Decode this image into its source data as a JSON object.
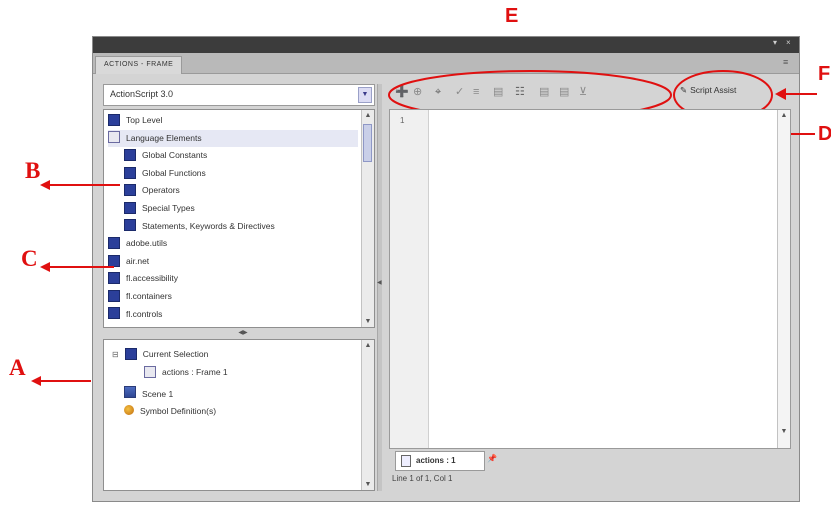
{
  "annotations": {
    "E": "E",
    "F": "F",
    "B": "B",
    "D": "D",
    "C": "C",
    "A": "A"
  },
  "panel": {
    "tab_label": "ACTIONS - FRAME"
  },
  "language_select": {
    "value": "ActionScript 3.0"
  },
  "toolbox": {
    "items": [
      {
        "label": "Top Level",
        "indent": 0,
        "icon": "closed"
      },
      {
        "label": "Language Elements",
        "indent": 0,
        "icon": "open"
      },
      {
        "label": "Global Constants",
        "indent": 1,
        "icon": "closed"
      },
      {
        "label": "Global Functions",
        "indent": 1,
        "icon": "closed"
      },
      {
        "label": "Operators",
        "indent": 1,
        "icon": "closed"
      },
      {
        "label": "Special Types",
        "indent": 1,
        "icon": "closed"
      },
      {
        "label": "Statements, Keywords & Directives",
        "indent": 1,
        "icon": "closed"
      },
      {
        "label": "adobe.utils",
        "indent": 0,
        "icon": "closed"
      },
      {
        "label": "air.net",
        "indent": 0,
        "icon": "closed"
      },
      {
        "label": "fl.accessibility",
        "indent": 0,
        "icon": "closed"
      },
      {
        "label": "fl.containers",
        "indent": 0,
        "icon": "closed"
      },
      {
        "label": "fl.controls",
        "indent": 0,
        "icon": "closed"
      }
    ]
  },
  "script_navigator": {
    "current_selection": "Current Selection",
    "frame_item": "actions : Frame 1",
    "scene": "Scene 1",
    "symbol_definitions": "Symbol Definition(s)"
  },
  "toolbar": {
    "script_assist_label": "Script Assist"
  },
  "editor": {
    "line_number": "1"
  },
  "script_tab": {
    "label": "actions : 1"
  },
  "status": {
    "text": "Line 1 of 1, Col 1"
  },
  "colors": {
    "annotation_red": "#e01010",
    "panel_gray": "#d4d4d4",
    "titlebar": "#3c3c3c"
  }
}
